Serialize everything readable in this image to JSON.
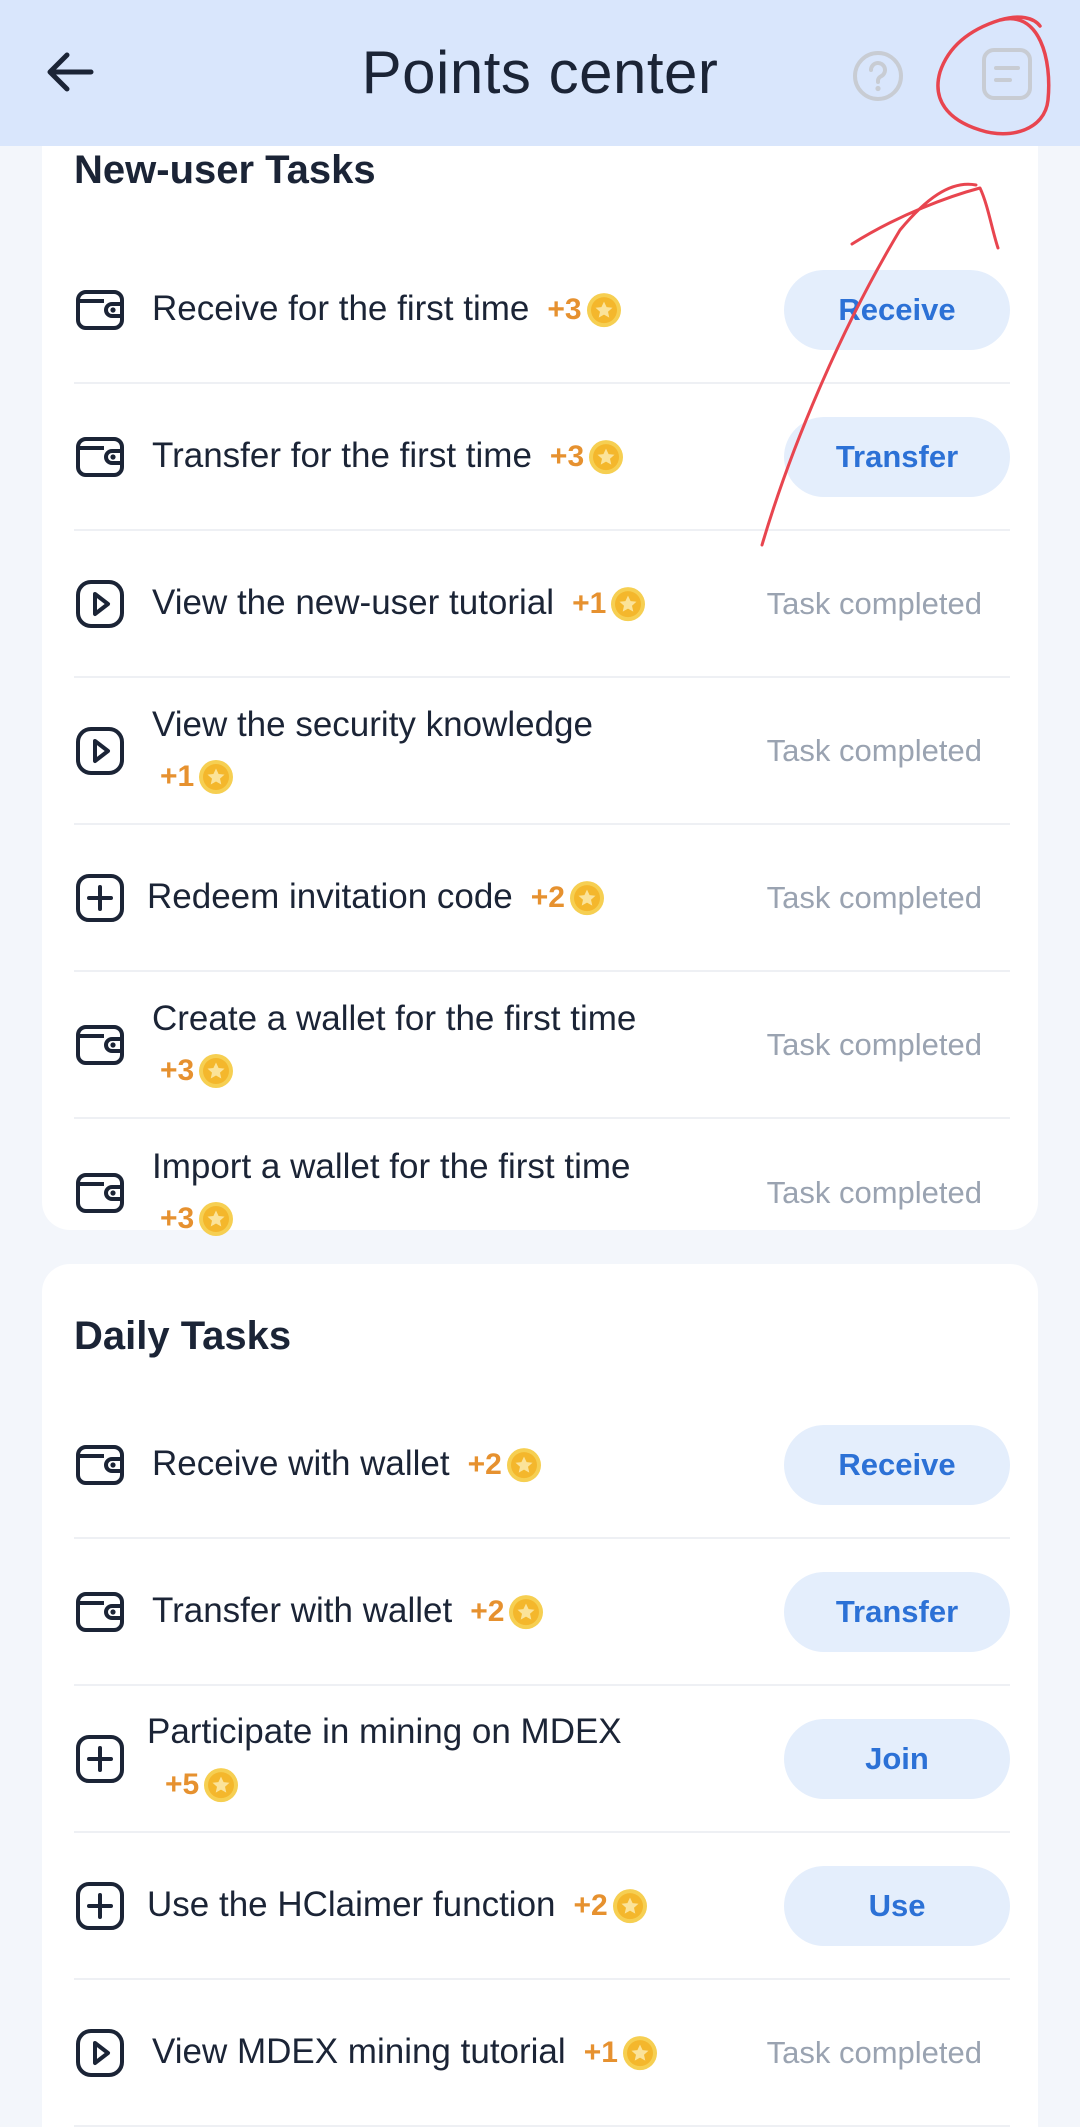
{
  "header": {
    "title": "Points center"
  },
  "new_user": {
    "title": "New-user Tasks",
    "tasks": [
      {
        "label": "Receive for the first time",
        "points": "+3",
        "action": "Receive"
      },
      {
        "label": "Transfer for the first time",
        "points": "+3",
        "action": "Transfer"
      },
      {
        "label": "View the new-user tutorial",
        "points": "+1",
        "status": "Task completed"
      },
      {
        "label": "View the security knowledge",
        "points": "+1",
        "status": "Task completed"
      },
      {
        "label": "Redeem invitation code",
        "points": "+2",
        "status": "Task completed"
      },
      {
        "label": "Create a wallet for the first time",
        "points": "+3",
        "status": "Task completed"
      },
      {
        "label": "Import a wallet for the first time",
        "points": "+3",
        "status": "Task completed"
      }
    ]
  },
  "daily": {
    "title": "Daily Tasks",
    "tasks": [
      {
        "label": "Receive with wallet",
        "points": "+2",
        "action": "Receive"
      },
      {
        "label": "Transfer with wallet",
        "points": "+2",
        "action": "Transfer"
      },
      {
        "label": "Participate in mining on MDEX",
        "points": "+5",
        "action": "Join"
      },
      {
        "label": "Use the HClaimer function",
        "points": "+2",
        "action": "Use"
      },
      {
        "label": "View MDEX mining tutorial",
        "points": "+1",
        "status": "Task completed"
      }
    ]
  },
  "colors": {
    "header_bg": "#d9e6fc",
    "accent": "#2c71d6",
    "points": "#e6912f",
    "annotation": "#e8454f"
  },
  "icons": [
    "back-arrow-icon",
    "help-icon",
    "records-icon",
    "wallet-icon",
    "play-icon",
    "plus-icon",
    "coin-star-icon",
    "annotation-circle",
    "annotation-arrow"
  ]
}
